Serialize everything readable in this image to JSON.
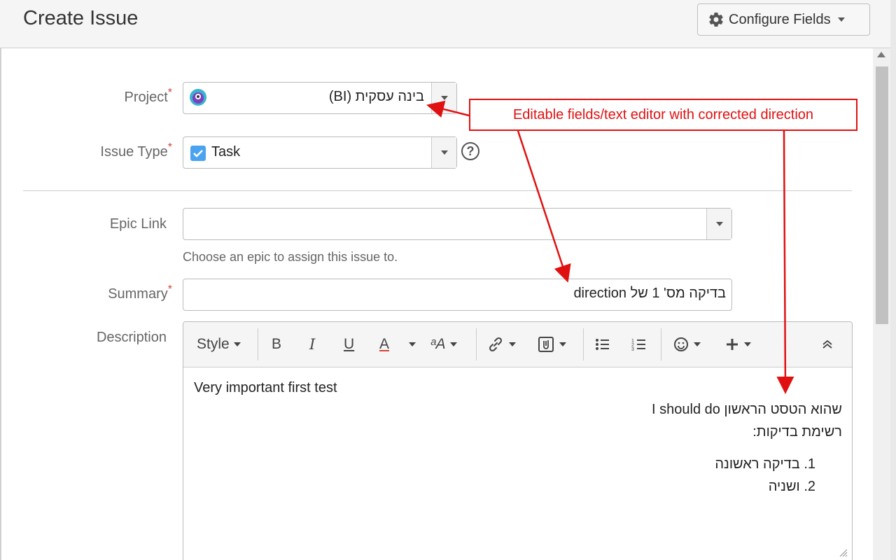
{
  "dialog": {
    "title": "Create Issue",
    "configure_fields_label": "Configure Fields"
  },
  "form": {
    "project": {
      "label": "Project",
      "required_mark": "*",
      "value": "בינה עסקית (BI)",
      "avatar_icon": "project-avatar-icon"
    },
    "issue_type": {
      "label": "Issue Type",
      "required_mark": "*",
      "value": "Task",
      "icon": "task-checkbox-icon",
      "help_glyph": "?"
    },
    "epic_link": {
      "label": "Epic Link",
      "value": "",
      "hint": "Choose an epic to assign this issue to."
    },
    "summary": {
      "label": "Summary",
      "required_mark": "*",
      "value": "בדיקה מס' 1 של direction"
    },
    "description": {
      "label": "Description",
      "toolbar": {
        "style_label": "Style",
        "bold": "B",
        "italic": "I",
        "underline": "U",
        "text_color": "A",
        "font_size": "ᵃA"
      },
      "content": {
        "line1": "Very important first test",
        "line2": "שהוא הטסט הראשון I should do",
        "line3": "רשימת בדיקות:",
        "list": [
          "בדיקה ראשונה",
          "ושניה"
        ],
        "list_numbers": [
          "1.",
          "2."
        ]
      }
    }
  },
  "annotation": {
    "text": "Editable fields/text editor with corrected direction",
    "color": "#e01010"
  },
  "colors": {
    "required": "#d04437",
    "task_icon": "#4ba3f0",
    "avatar": "#7b3fbf"
  }
}
